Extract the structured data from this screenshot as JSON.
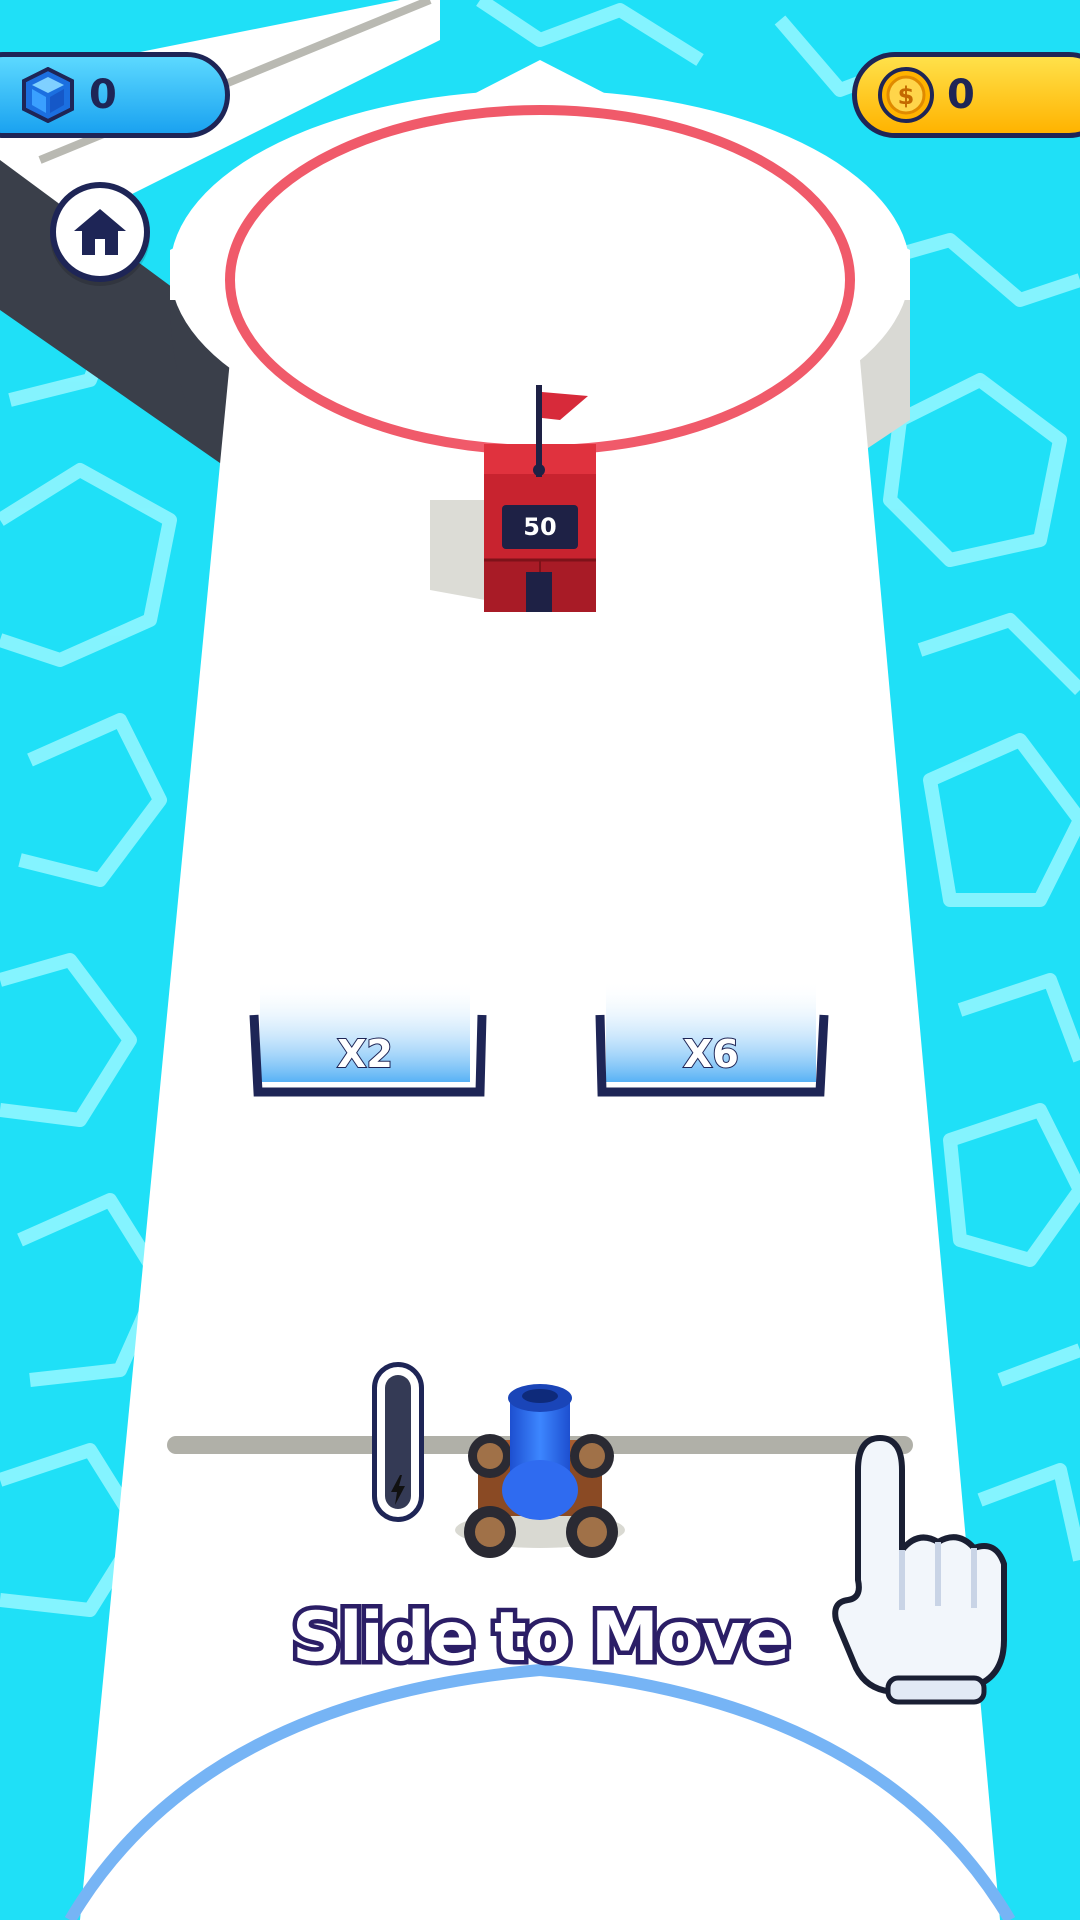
{
  "hud": {
    "gems": {
      "icon": "gem-cube-icon",
      "value": "0",
      "color": "#1aa2f0"
    },
    "coins": {
      "icon": "coin-dollar-icon",
      "value": "0",
      "color": "#ffc107"
    },
    "home_icon": "home-icon"
  },
  "level": {
    "target_tower_health": "50",
    "gates": [
      {
        "label": "X2"
      },
      {
        "label": "X6"
      }
    ],
    "power_icon": "lightning-icon"
  },
  "tutorial": {
    "text": "Slide to Move",
    "hand_icon": "pointing-hand-icon"
  },
  "colors": {
    "water": "#1fe0f7",
    "track": "#ffffff",
    "target_ring": "#f05a6a",
    "start_ring": "#76b4f5",
    "tower": "#c8232f",
    "cannon": "#1f5fe0",
    "outline": "#1e2556"
  }
}
